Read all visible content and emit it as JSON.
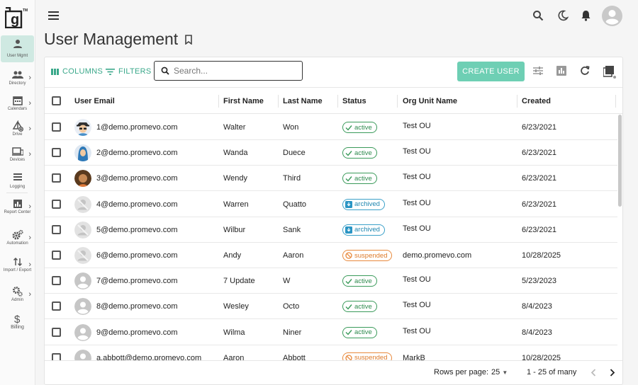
{
  "brand": {
    "logo_text": "g",
    "trademark": "TM"
  },
  "sidebar": {
    "items": [
      {
        "label": "User Mgmt",
        "icon": "person-icon",
        "active": true
      },
      {
        "label": "Directory",
        "icon": "people-icon"
      },
      {
        "label": "Calendars",
        "icon": "calendar-icon"
      },
      {
        "label": "Drive",
        "icon": "drive-icon"
      },
      {
        "label": "Devices",
        "icon": "devices-icon"
      },
      {
        "label": "Logging",
        "icon": "list-icon"
      },
      {
        "label": "Report Center",
        "icon": "report-icon"
      },
      {
        "label": "Automation",
        "icon": "gears-icon"
      },
      {
        "label": "Import / Export",
        "icon": "swap-icon"
      },
      {
        "label": "Admin",
        "icon": "admin-gear-icon"
      },
      {
        "label": "Billing",
        "icon": "dollar-icon"
      }
    ]
  },
  "header": {
    "title": "User Management"
  },
  "toolbar": {
    "columns_label": "COLUMNS",
    "filters_label": "FILTERS",
    "search_placeholder": "Search...",
    "create_label": "CREATE USER"
  },
  "table": {
    "columns": [
      "User Email",
      "First Name",
      "Last Name",
      "Status",
      "Org Unit Name",
      "Created"
    ],
    "rows": [
      {
        "email": "1@demo.promevo.com",
        "first": "Walter",
        "last": "Won",
        "status": "active",
        "org": "Test OU",
        "created": "6/23/2021",
        "avatar": "hat"
      },
      {
        "email": "2@demo.promevo.com",
        "first": "Wanda",
        "last": "Duece",
        "status": "active",
        "org": "Test OU",
        "created": "6/23/2021",
        "avatar": "hijab"
      },
      {
        "email": "3@demo.promevo.com",
        "first": "Wendy",
        "last": "Third",
        "status": "active",
        "org": "Test OU",
        "created": "6/23/2021",
        "avatar": "curly"
      },
      {
        "email": "4@demo.promevo.com",
        "first": "Warren",
        "last": "Quatto",
        "status": "archived",
        "org": "Test OU",
        "created": "6/23/2021",
        "avatar": "archived"
      },
      {
        "email": "5@demo.promevo.com",
        "first": "Wilbur",
        "last": "Sank",
        "status": "archived",
        "org": "Test OU",
        "created": "6/23/2021",
        "avatar": "archived"
      },
      {
        "email": "6@demo.promevo.com",
        "first": "Andy",
        "last": "Aaron",
        "status": "suspended",
        "org": "demo.promevo.com",
        "created": "10/28/2025",
        "avatar": "archived"
      },
      {
        "email": "7@demo.promevo.com",
        "first": "7 Update",
        "last": "W",
        "status": "active",
        "org": "Test OU",
        "created": "5/23/2023",
        "avatar": "default"
      },
      {
        "email": "8@demo.promevo.com",
        "first": "Wesley",
        "last": "Octo",
        "status": "active",
        "org": "Test OU",
        "created": "8/4/2023",
        "avatar": "default"
      },
      {
        "email": "9@demo.promevo.com",
        "first": "Wilma",
        "last": "Niner",
        "status": "active",
        "org": "Test OU",
        "created": "8/4/2023",
        "avatar": "default"
      },
      {
        "email": "a.abbott@demo.promevo.com",
        "first": "Aaron",
        "last": "Abbott",
        "status": "suspended",
        "org": "MarkB",
        "created": "10/28/2025",
        "avatar": "default"
      }
    ]
  },
  "footer": {
    "rows_per_page_label": "Rows per page:",
    "rows_per_page_value": "25",
    "range": "1 - 25 of many"
  },
  "colors": {
    "accent": "#6ecfb4",
    "active": "#2e8a4e",
    "archived": "#1e86b0",
    "suspended": "#dd7a2a"
  }
}
